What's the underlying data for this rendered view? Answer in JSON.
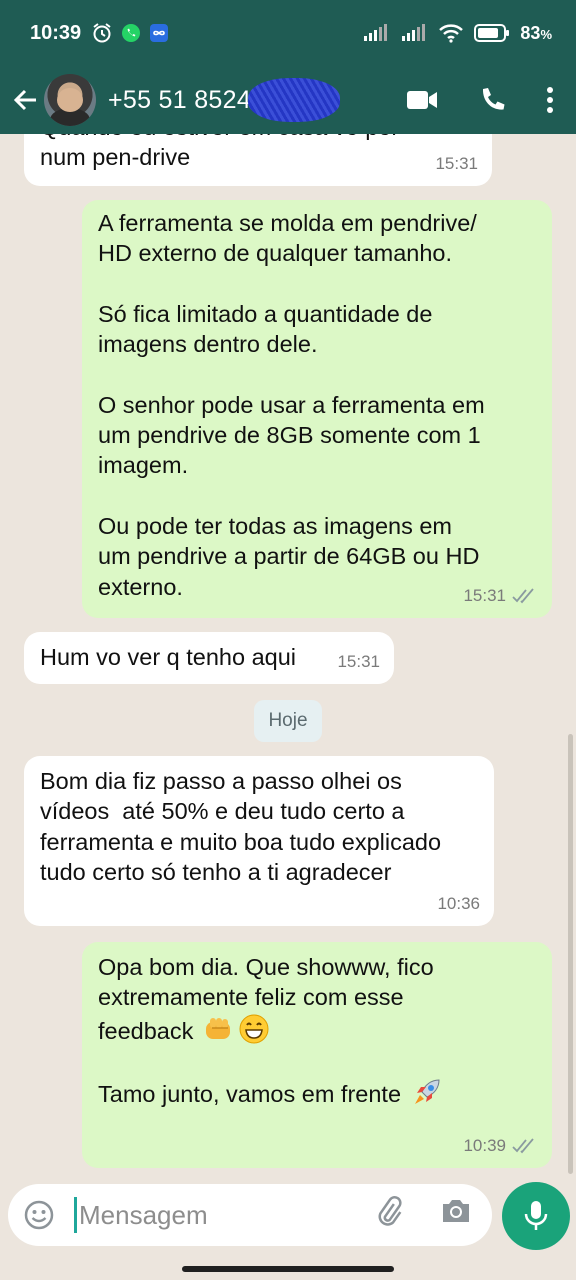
{
  "status_bar": {
    "time": "10:39",
    "battery": "83",
    "battery_unit": "%",
    "icons": [
      "alarm-icon",
      "whatsapp-icon",
      "link-icon",
      "signal-icon",
      "wifi-icon",
      "battery-icon"
    ]
  },
  "header": {
    "contact_name": "+55 51 8524",
    "actions": [
      "video-call-icon",
      "voice-call-icon",
      "more-options-icon"
    ]
  },
  "messages": [
    {
      "direction": "in",
      "text": "Quando eu estiver em casa vo por\nnum pen-drive",
      "time": "15:31"
    },
    {
      "direction": "out",
      "text": "A ferramenta se molda em pendrive/\nHD externo de qualquer tamanho.\n\nSó fica limitado a quantidade de\nimagens dentro dele.\n\nO senhor pode usar a ferramenta em\num pendrive de 8GB somente com 1\nimagem.\n\nOu pode ter todas as imagens em\num pendrive a partir de 64GB ou HD\nexterno.",
      "time": "15:31",
      "read": true
    },
    {
      "direction": "in",
      "text": "Hum vo ver q tenho aqui",
      "time": "15:31"
    },
    {
      "direction": "in",
      "text": "Bom dia fiz passo a passo olhei os\nvídeos  até 50% e deu tudo certo a\nferramenta e muito boa tudo explicado\ntudo certo só tenho a ti agradecer",
      "time": "10:36"
    },
    {
      "direction": "out",
      "text_line1": "Opa bom dia. Que showww, fico",
      "text_line2": "extremamente feliz com esse",
      "text_line3": "feedback",
      "text_line5": "Tamo junto, vamos em frente",
      "time": "10:39",
      "read": true
    }
  ],
  "date_separator": "Hoje",
  "composer": {
    "placeholder": "Mensagem"
  },
  "colors": {
    "header": "#1f5c54",
    "incoming_bubble": "#ffffff",
    "outgoing_bubble": "#dcf8c6",
    "mic_button": "#1aa37a",
    "read_ticks": "#8a9aa0"
  }
}
